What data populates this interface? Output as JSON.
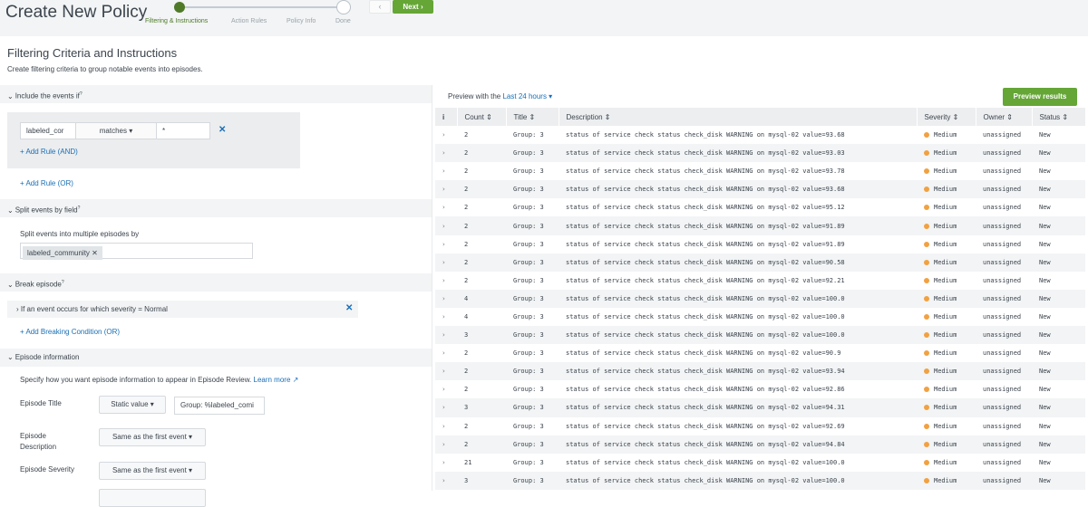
{
  "header": {
    "title": "Create New Policy",
    "steps": [
      "Filtering & Instructions",
      "Action Rules",
      "Policy Info",
      "Done"
    ],
    "back_label": "‹",
    "next_label": "Next ›"
  },
  "section": {
    "title": "Filtering Criteria and Instructions",
    "subtitle": "Create filtering criteria to group notable events into episodes."
  },
  "include": {
    "header": "Include the events if",
    "help": "?",
    "field": "labeled_cor",
    "operator": "matches ▾",
    "value": "*",
    "remove": "✕",
    "add_and": "+ Add Rule (AND)",
    "add_or": "+ Add Rule (OR)"
  },
  "split": {
    "header": "Split events by field",
    "help": "?",
    "label": "Split events into multiple episodes by",
    "tag": "labeled_community ✕"
  },
  "break": {
    "header": "Break episode",
    "help": "?",
    "condition": "› If an event occurs for which severity = Normal",
    "remove": "✕",
    "add": "+ Add Breaking Condition (OR)"
  },
  "episode": {
    "header": "Episode information",
    "description": "Specify how you want episode information to appear in Episode Review.",
    "learn_more": "Learn more ↗",
    "title_label": "Episode Title",
    "title_mode": "Static value ▾",
    "title_value": "Group: %labeled_comi",
    "desc_label_1": "Episode",
    "desc_label_2": "Description",
    "desc_mode": "Same as the first event ▾",
    "severity_label": "Episode Severity",
    "severity_mode": "Same as the first event ▾"
  },
  "preview": {
    "label": "Preview with the",
    "time": "Last 24 hours ▾",
    "button": "Preview results",
    "columns": [
      "i",
      "Count ⇕",
      "Title ⇕",
      "Description ⇕",
      "Severity ⇕",
      "Owner ⇕",
      "Status ⇕"
    ],
    "rows": [
      {
        "count": "2",
        "title": "Group: 3",
        "desc": "status of service check status check_disk WARNING on mysql-02  value=93.68",
        "severity": "Medium",
        "owner": "unassigned",
        "status": "New"
      },
      {
        "count": "2",
        "title": "Group: 3",
        "desc": "status of service check status check_disk WARNING on mysql-02  value=93.03",
        "severity": "Medium",
        "owner": "unassigned",
        "status": "New"
      },
      {
        "count": "2",
        "title": "Group: 3",
        "desc": "status of service check status check_disk WARNING on mysql-02  value=93.78",
        "severity": "Medium",
        "owner": "unassigned",
        "status": "New"
      },
      {
        "count": "2",
        "title": "Group: 3",
        "desc": "status of service check status check_disk WARNING on mysql-02  value=93.68",
        "severity": "Medium",
        "owner": "unassigned",
        "status": "New"
      },
      {
        "count": "2",
        "title": "Group: 3",
        "desc": "status of service check status check_disk WARNING on mysql-02  value=95.12",
        "severity": "Medium",
        "owner": "unassigned",
        "status": "New"
      },
      {
        "count": "2",
        "title": "Group: 3",
        "desc": "status of service check status check_disk WARNING on mysql-02  value=91.89",
        "severity": "Medium",
        "owner": "unassigned",
        "status": "New"
      },
      {
        "count": "2",
        "title": "Group: 3",
        "desc": "status of service check status check_disk WARNING on mysql-02  value=91.89",
        "severity": "Medium",
        "owner": "unassigned",
        "status": "New"
      },
      {
        "count": "2",
        "title": "Group: 3",
        "desc": "status of service check status check_disk WARNING on mysql-02  value=90.58",
        "severity": "Medium",
        "owner": "unassigned",
        "status": "New"
      },
      {
        "count": "2",
        "title": "Group: 3",
        "desc": "status of service check status check_disk WARNING on mysql-02  value=92.21",
        "severity": "Medium",
        "owner": "unassigned",
        "status": "New"
      },
      {
        "count": "4",
        "title": "Group: 3",
        "desc": "status of service check status check_disk WARNING on mysql-02  value=100.0",
        "severity": "Medium",
        "owner": "unassigned",
        "status": "New"
      },
      {
        "count": "4",
        "title": "Group: 3",
        "desc": "status of service check status check_disk WARNING on mysql-02  value=100.0",
        "severity": "Medium",
        "owner": "unassigned",
        "status": "New"
      },
      {
        "count": "3",
        "title": "Group: 3",
        "desc": "status of service check status check_disk WARNING on mysql-02  value=100.0",
        "severity": "Medium",
        "owner": "unassigned",
        "status": "New"
      },
      {
        "count": "2",
        "title": "Group: 3",
        "desc": "status of service check status check_disk WARNING on mysql-02  value=90.9",
        "severity": "Medium",
        "owner": "unassigned",
        "status": "New"
      },
      {
        "count": "2",
        "title": "Group: 3",
        "desc": "status of service check status check_disk WARNING on mysql-02  value=93.94",
        "severity": "Medium",
        "owner": "unassigned",
        "status": "New"
      },
      {
        "count": "2",
        "title": "Group: 3",
        "desc": "status of service check status check_disk WARNING on mysql-02  value=92.86",
        "severity": "Medium",
        "owner": "unassigned",
        "status": "New"
      },
      {
        "count": "3",
        "title": "Group: 3",
        "desc": "status of service check status check_disk WARNING on mysql-02  value=94.31",
        "severity": "Medium",
        "owner": "unassigned",
        "status": "New"
      },
      {
        "count": "2",
        "title": "Group: 3",
        "desc": "status of service check status check_disk WARNING on mysql-02  value=92.69",
        "severity": "Medium",
        "owner": "unassigned",
        "status": "New"
      },
      {
        "count": "2",
        "title": "Group: 3",
        "desc": "status of service check status check_disk WARNING on mysql-02  value=94.84",
        "severity": "Medium",
        "owner": "unassigned",
        "status": "New"
      },
      {
        "count": "21",
        "title": "Group: 3",
        "desc": "status of service check status check_disk WARNING on mysql-02  value=100.0",
        "severity": "Medium",
        "owner": "unassigned",
        "status": "New"
      },
      {
        "count": "3",
        "title": "Group: 3",
        "desc": "status of service check status check_disk WARNING on mysql-02  value=100.0",
        "severity": "Medium",
        "owner": "unassigned",
        "status": "New"
      }
    ]
  },
  "colors": {
    "accent_green": "#65a637",
    "step_active": "#4f7a28",
    "link_blue": "#1a6fb5",
    "severity_medium": "#f1a141"
  }
}
